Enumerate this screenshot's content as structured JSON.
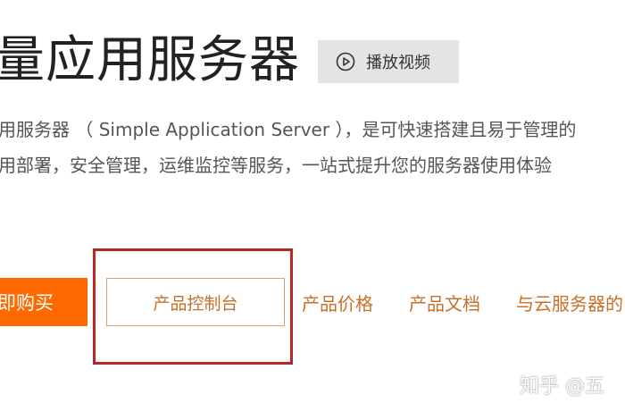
{
  "header": {
    "title": "量应用服务器",
    "video_button_label": "播放视频",
    "video_icon": "play-circle-icon"
  },
  "description": {
    "line1": "用服务器 （ Simple Application Server ），是可快速搭建且易于管理的",
    "line2": "用部署，安全管理，运维监控等服务，一站式提升您的服务器使用体验"
  },
  "actions": {
    "buy_label": "即购买",
    "console_label": "产品控制台",
    "price_label": "产品价格",
    "docs_label": "产品文档",
    "compare_label": "与云服务器的"
  },
  "watermark": {
    "text": "知乎 @五"
  },
  "colors": {
    "accent_orange": "#ff6a00",
    "link_orange": "#c7702a",
    "highlight_red": "#b8282a",
    "video_button_bg": "#e4e4e4"
  }
}
